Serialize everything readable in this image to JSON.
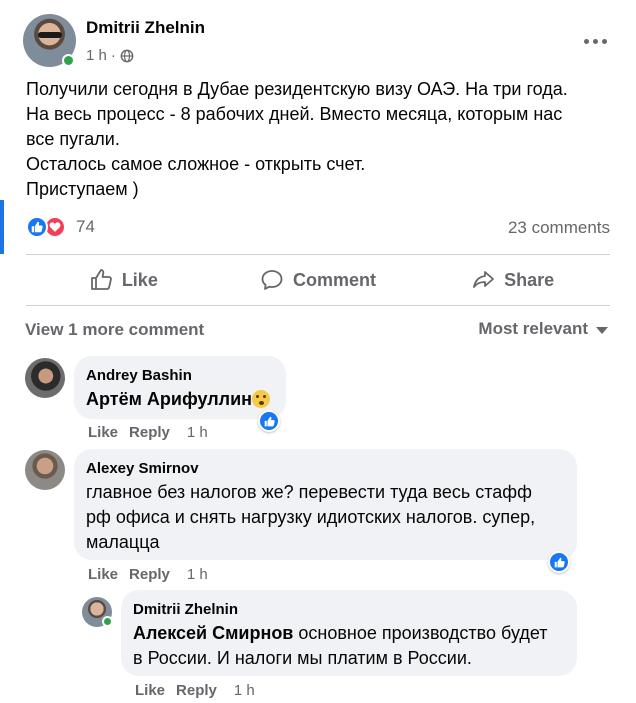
{
  "post": {
    "author": "Dmitrii Zhelnin",
    "time": "1 h",
    "separator": "·",
    "text_lines": [
      "Получили сегодня в Дубае резидентскую визу ОАЭ. На три года.",
      "На весь процесс - 8 рабочих дней. Вместо месяца, которым нас",
      "все пугали.",
      "Осталось самое сложное - открыть счет.",
      "Приступаем )"
    ],
    "reaction_count": "74",
    "comments_count": "23 comments"
  },
  "actions": {
    "like": "Like",
    "comment": "Comment",
    "share": "Share"
  },
  "comments_header": {
    "view_more": "View 1 more comment",
    "sort": "Most relevant"
  },
  "comments": [
    {
      "author": "Andrey Bashin",
      "mention": "Артём Арифуллин",
      "text": "",
      "like": "Like",
      "reply": "Reply",
      "time": "1 h"
    },
    {
      "author": "Alexey Smirnov",
      "text_lines": [
        "главное без налогов же? перевести туда весь стафф",
        "рф офиса и снять нагрузку идиотских налогов. супер,",
        "малацца"
      ],
      "like": "Like",
      "reply": "Reply",
      "time": "1 h"
    },
    {
      "author": "Dmitrii Zhelnin",
      "mention": "Алексей Смирнов",
      "text_line1": " основное производство будет",
      "text_line2": "в России. И налоги мы платим в России.",
      "like": "Like",
      "reply": "Reply",
      "time": "1 h"
    }
  ],
  "colors": {
    "accent": "#1877f2",
    "love": "#f33e58",
    "secondary_text": "#65676b",
    "bubble": "#f0f2f5",
    "online": "#31a24c"
  },
  "icons": [
    "globe-icon",
    "more-icon",
    "like-reaction-icon",
    "love-reaction-icon",
    "thumbs-up-icon",
    "comment-icon",
    "share-icon",
    "caret-down-icon"
  ]
}
